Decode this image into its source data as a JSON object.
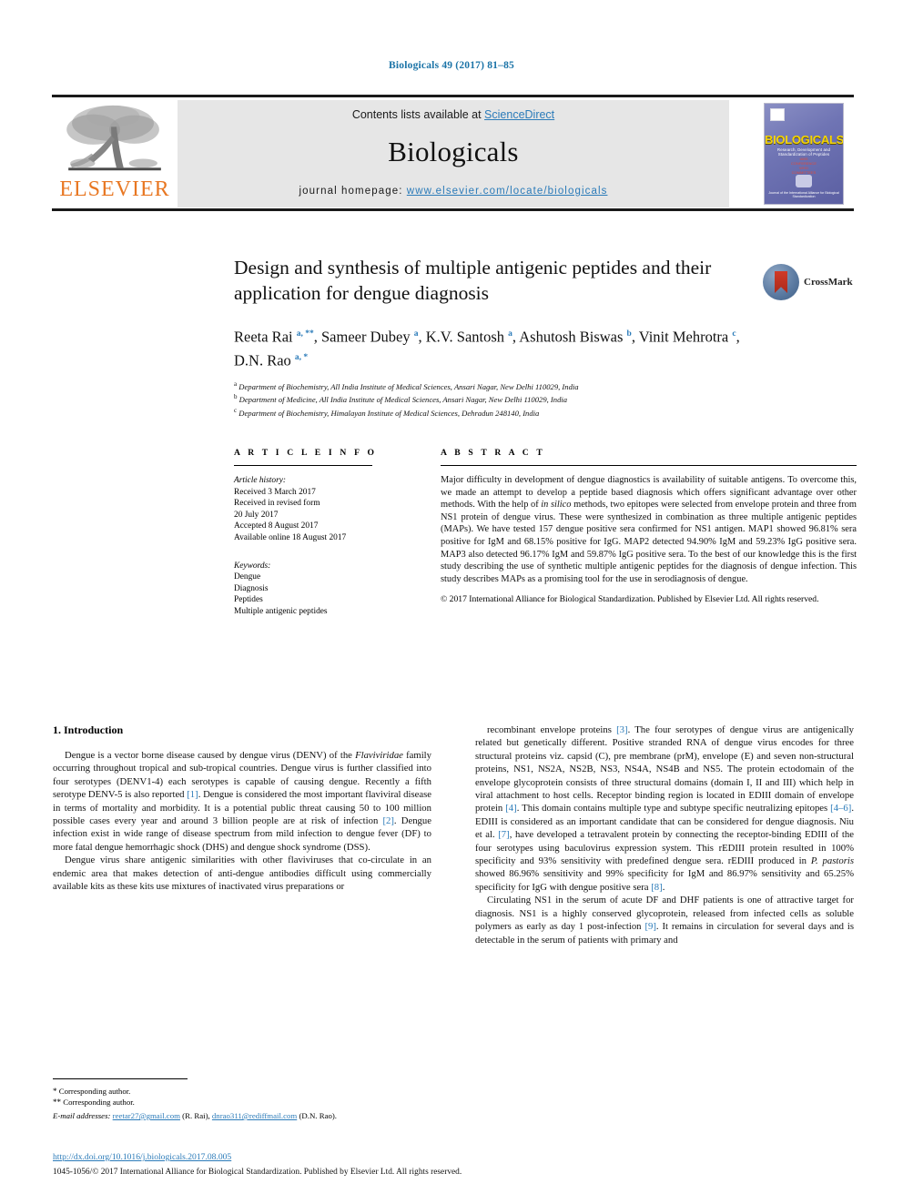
{
  "running_head": "Biologicals 49 (2017) 81–85",
  "masthead": {
    "contents_prefix": "Contents lists available at ",
    "sciencedirect": "ScienceDirect",
    "journal_name": "Biologicals",
    "homepage_prefix": "journal homepage: ",
    "homepage_url": "www.elsevier.com/locate/biologicals",
    "publisher_wordmark": "ELSEVIER",
    "publisher_logo_icon": "elsevier-tree-icon",
    "cover": {
      "title": "BIOLOGICALS",
      "subtitle": "Research, Development and Standardization of Peptides",
      "red_lines": "IABS\nCONFERENCE\nWHO\nCOMMITTEES",
      "footer": "Journal of the International Alliance for Biological Standardization"
    }
  },
  "article": {
    "title": "Design and synthesis of multiple antigenic peptides and their application for dengue diagnosis",
    "authors": [
      {
        "name": "Reeta Rai",
        "marks": "a, **"
      },
      {
        "name": "Sameer Dubey",
        "marks": "a"
      },
      {
        "name": "K.V. Santosh",
        "marks": "a"
      },
      {
        "name": "Ashutosh Biswas",
        "marks": "b"
      },
      {
        "name": "Vinit Mehrotra",
        "marks": "c"
      },
      {
        "name": "D.N. Rao",
        "marks": "a, *"
      }
    ],
    "affiliations": [
      {
        "mark": "a",
        "text": "Department of Biochemistry, All India Institute of Medical Sciences, Ansari Nagar, New Delhi 110029, India"
      },
      {
        "mark": "b",
        "text": "Department of Medicine, All India Institute of Medical Sciences, Ansari Nagar, New Delhi 110029, India"
      },
      {
        "mark": "c",
        "text": "Department of Biochemistry, Himalayan Institute of Medical Sciences, Dehradun 248140, India"
      }
    ],
    "crossmark_label": "CrossMark",
    "crossmark_icon": "crossmark-badge-icon"
  },
  "article_info": {
    "heading": "A R T I C L E    I N F O",
    "history_label": "Article history:",
    "history": [
      "Received 3 March 2017",
      "Received in revised form",
      "20 July 2017",
      "Accepted 8 August 2017",
      "Available online 18 August 2017"
    ],
    "keywords_label": "Keywords:",
    "keywords": [
      "Dengue",
      "Diagnosis",
      "Peptides",
      "Multiple antigenic peptides"
    ]
  },
  "abstract": {
    "heading": "A B S T R A C T",
    "text": "Major difficulty in development of dengue diagnostics is availability of suitable antigens. To overcome this, we made an attempt to develop a peptide based diagnosis which offers significant advantage over other methods. With the help of in silico methods, two epitopes were selected from envelope protein and three from NS1 protein of dengue virus. These were synthesized in combination as three multiple antigenic peptides (MAPs). We have tested 157 dengue positive sera confirmed for NS1 antigen. MAP1 showed 96.81% sera positive for IgM and 68.15% positive for IgG. MAP2 detected 94.90% IgM and 59.23% IgG positive sera. MAP3 also detected 96.17% IgM and 59.87% IgG positive sera. To the best of our knowledge this is the first study describing the use of synthetic multiple antigenic peptides for the diagnosis of dengue infection. This study describes MAPs as a promising tool for the use in serodiagnosis of dengue.",
    "copyright": "© 2017 International Alliance for Biological Standardization. Published by Elsevier Ltd. All rights reserved."
  },
  "body": {
    "section_number_title": "1.  Introduction",
    "left_paragraphs": [
      "Dengue is a vector borne disease caused by dengue virus (DENV) of the Flaviviridae family occurring throughout tropical and sub-tropical countries. Dengue virus is further classified into four serotypes (DENV1-4) each serotypes is capable of causing dengue. Recently a fifth serotype DENV-5 is also reported [1]. Dengue is considered the most important flaviviral disease in terms of mortality and morbidity. It is a potential public threat causing 50 to 100 million possible cases every year and around 3 billion people are at risk of infection [2]. Dengue infection exist in wide range of disease spectrum from mild infection to dengue fever (DF) to more fatal dengue hemorrhagic shock (DHS) and dengue shock syndrome (DSS).",
      "Dengue virus share antigenic similarities with other flaviviruses that co-circulate in an endemic area that makes detection of anti-dengue antibodies difficult using commercially available kits as these kits use mixtures of inactivated virus preparations or"
    ],
    "right_paragraphs": [
      "recombinant envelope proteins [3]. The four serotypes of dengue virus are antigenically related but genetically different. Positive stranded RNA of dengue virus encodes for three structural proteins viz. capsid (C), pre membrane (prM), envelope (E) and seven non-structural proteins, NS1, NS2A, NS2B, NS3, NS4A, NS4B and NS5. The protein ectodomain of the envelope glycoprotein consists of three structural domains (domain I, II and III) which help in viral attachment to host cells. Receptor binding region is located in EDIII domain of envelope protein [4]. This domain contains multiple type and subtype specific neutralizing epitopes [4–6]. EDIII is considered as an important candidate that can be considered for dengue diagnosis. Niu et al. [7], have developed a tetravalent protein by connecting the receptor-binding EDIII of the four serotypes using baculovirus expression system. This rEDIII protein resulted in 100% specificity and 93% sensitivity with predefined dengue sera. rEDIII produced in P. pastoris showed 86.96% sensitivity and 99% specificity for IgM and 86.97% sensitivity and 65.25% specificity for IgG with dengue positive sera [8].",
      "Circulating NS1 in the serum of acute DF and DHF patients is one of attractive target for diagnosis. NS1 is a highly conserved glycoprotein, released from infected cells as soluble polymers as early as day 1 post-infection [9]. It remains in circulation for several days and is detectable in the serum of patients with primary and"
    ]
  },
  "footnotes": {
    "corresponding_1": "Corresponding author.",
    "corresponding_2": "Corresponding author.",
    "email_label": "E-mail addresses:",
    "email_1": "reetar27@gmail.com",
    "email_1_owner": "(R. Rai),",
    "email_2": "dnrao311@rediffmail.com",
    "email_2_owner": "(D.N. Rao)."
  },
  "bottom": {
    "doi": "http://dx.doi.org/10.1016/j.biologicals.2017.08.005",
    "issn_line": "1045-1056/© 2017 International Alliance for Biological Standardization. Published by Elsevier Ltd. All rights reserved."
  },
  "colors": {
    "link": "#2b7bb9",
    "elsevier_orange": "#E87722",
    "rule": "#1a1a1a"
  }
}
